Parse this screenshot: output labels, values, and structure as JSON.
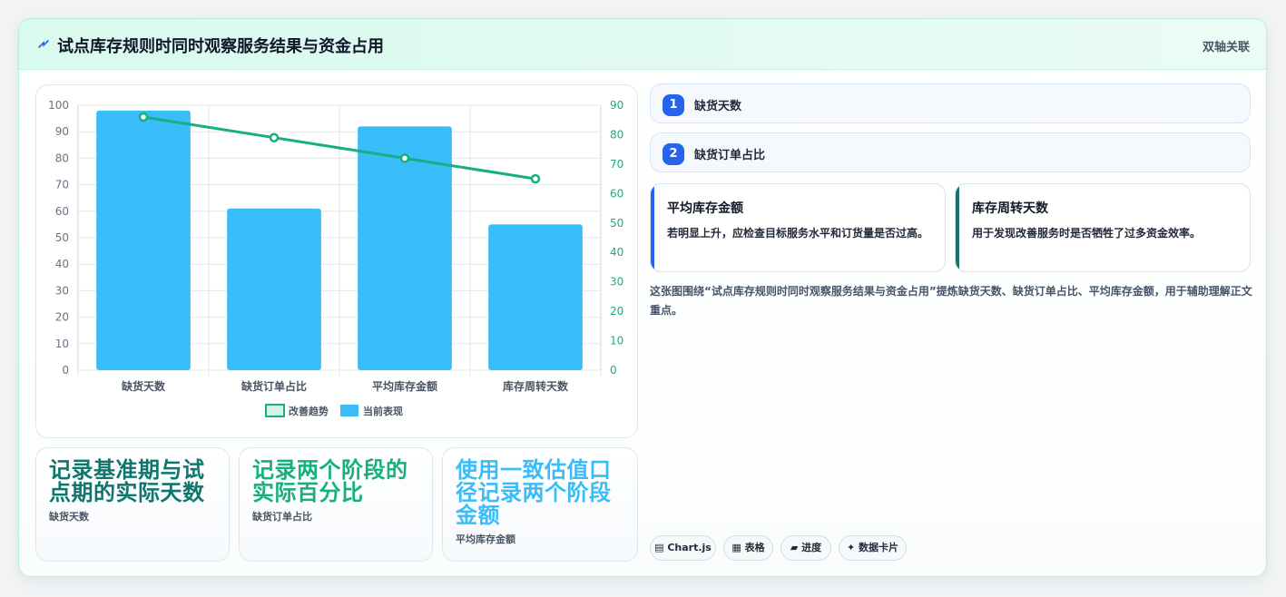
{
  "header": {
    "title": "试点库存规则时同时观察服务结果与资金占用",
    "tag": "双轴关联"
  },
  "chart_data": {
    "type": "bar",
    "categories": [
      "缺货天数",
      "缺货订单占比",
      "平均库存金额",
      "库存周转天数"
    ],
    "series": [
      {
        "name": "当前表现",
        "type": "bar",
        "axis": "left",
        "values": [
          98,
          61,
          92,
          55
        ],
        "color": "#38bdf8"
      },
      {
        "name": "改善趋势",
        "type": "line",
        "axis": "right",
        "values": [
          86,
          79,
          72,
          65
        ],
        "color": "#16b07e"
      }
    ],
    "y_left": {
      "min": 0,
      "max": 100,
      "step": 10
    },
    "y_right": {
      "min": 0,
      "max": 90,
      "step": 10
    },
    "legend_position": "bottom",
    "grid": true
  },
  "stats": [
    {
      "big": "记录基准期与试点期的实际天数",
      "small": "缺货天数",
      "color": "#0f766e"
    },
    {
      "big": "记录两个阶段的实际百分比",
      "small": "缺货订单占比",
      "color": "#16b07e"
    },
    {
      "big": "使用一致估值口径记录两个阶段金额",
      "small": "平均库存金额",
      "color": "#38bdf8"
    }
  ],
  "rows": [
    {
      "num": "1",
      "label": "缺货天数"
    },
    {
      "num": "2",
      "label": "缺货订单占比"
    }
  ],
  "info_cards": [
    {
      "title": "平均库存金额",
      "text": "若明显上升，应检查目标服务水平和订货量是否过高。",
      "color": "#2563eb"
    },
    {
      "title": "库存周转天数",
      "text": "用于发现改善服务时是否牺牲了过多资金效率。",
      "color": "#0f766e"
    }
  ],
  "description": "这张图围绕“试点库存规则时同时观察服务结果与资金占用”提炼缺货天数、缺货订单占比、平均库存金额，用于辅助理解正文重点。",
  "chips": [
    {
      "icon": "chart-icon",
      "label": "▤ Chart.js"
    },
    {
      "icon": "table-icon",
      "label": "▦ 表格"
    },
    {
      "icon": "progress-icon",
      "label": "▰ 进度"
    },
    {
      "icon": "sparkle-icon",
      "label": "✦ 数据卡片"
    }
  ]
}
